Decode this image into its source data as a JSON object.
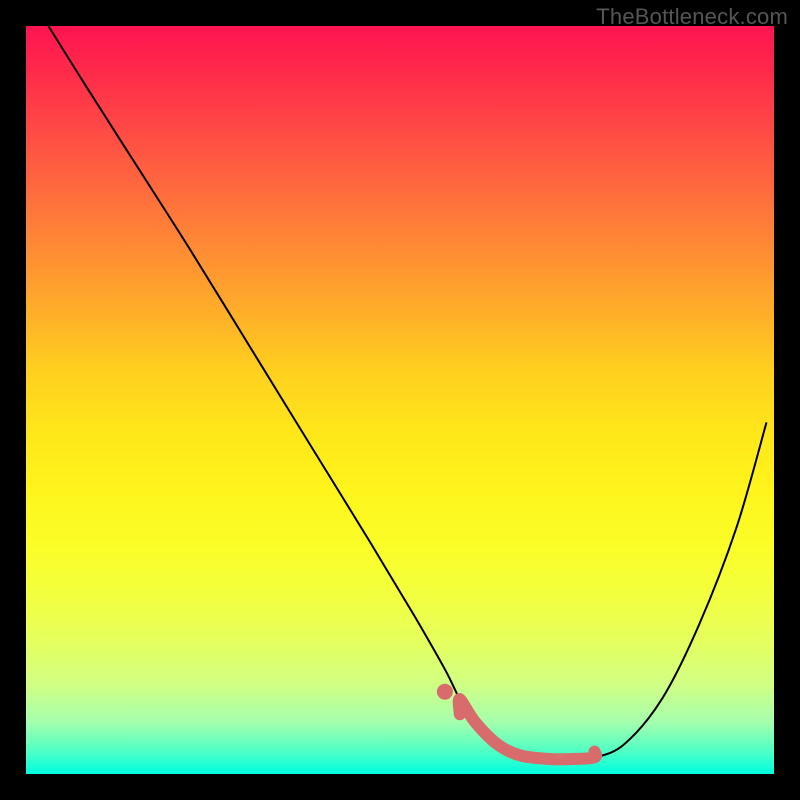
{
  "watermark": "TheBottleneck.com",
  "colors": {
    "background": "#000000",
    "curve": "#000000",
    "highlight": "#d86b6b",
    "watermark": "#565656"
  },
  "chart_data": {
    "type": "line",
    "title": "",
    "xlabel": "",
    "ylabel": "",
    "xlim": [
      0,
      100
    ],
    "ylim": [
      0,
      100
    ],
    "series": [
      {
        "name": "bottleneck-curve",
        "x": [
          3,
          8,
          15,
          22,
          30,
          38,
          46,
          52,
          56,
          58,
          60,
          63,
          66,
          70,
          73,
          76,
          80,
          85,
          90,
          95,
          99
        ],
        "y": [
          100,
          92,
          81,
          70,
          57,
          44,
          31,
          21,
          14,
          10,
          7,
          4,
          2.5,
          2,
          2,
          2.2,
          4,
          10,
          20,
          33,
          47
        ]
      }
    ],
    "annotations": [
      {
        "name": "highlight-band",
        "x_range": [
          58,
          76
        ],
        "y_level": 2
      }
    ]
  }
}
